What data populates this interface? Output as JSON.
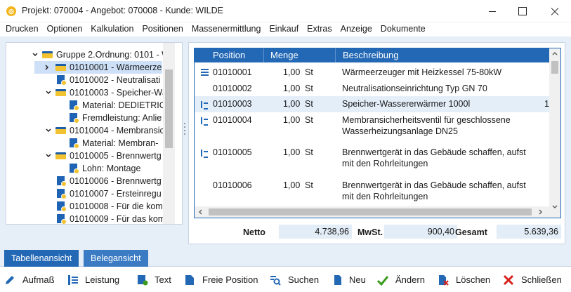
{
  "window": {
    "title": "Projekt: 070004 - Angebot: 070008 - Kunde: WILDE"
  },
  "menu": [
    "Drucken",
    "Optionen",
    "Kalkulation",
    "Positionen",
    "Massenermittlung",
    "Einkauf",
    "Extras",
    "Anzeige",
    "Dokumente"
  ],
  "tree": [
    {
      "label": "Gruppe 2.Ordnung: 0101 - W",
      "icon": "folder-icon"
    },
    {
      "label": "01010001 - Wärmeerze",
      "icon": "folder-icon"
    },
    {
      "label": "01010002 - Neutralisati",
      "icon": "document-icon"
    },
    {
      "label": "01010003 - Speicher-Wä",
      "icon": "folder-icon"
    },
    {
      "label": "Material: DEDIETRIC",
      "icon": "document-icon"
    },
    {
      "label": "Fremdleistung: Anlie",
      "icon": "document-icon"
    },
    {
      "label": "01010004 - Membransic",
      "icon": "folder-icon"
    },
    {
      "label": "Material: Membran-",
      "icon": "document-icon"
    },
    {
      "label": "01010005 - Brennwertg",
      "icon": "folder-icon"
    },
    {
      "label": "Lohn: Montage",
      "icon": "document-icon"
    },
    {
      "label": "01010006 - Brennwertg",
      "icon": "document-icon"
    },
    {
      "label": "01010007 - Ersteinregu",
      "icon": "document-icon"
    },
    {
      "label": "01010008 - Für die kom",
      "icon": "document-icon"
    },
    {
      "label": "01010009 - Für das kom",
      "icon": "document-icon"
    }
  ],
  "grid": {
    "headers": {
      "position": "Position",
      "menge": "Menge",
      "beschreibung": "Beschreibung"
    },
    "rows": [
      {
        "icon": "list-lines-icon",
        "position": "01010001",
        "menge": "1,00",
        "unit": "St",
        "desc1": "Wärmeerzeuger mit Heizkessel 75-80kW",
        "desc2": ""
      },
      {
        "icon": "",
        "position": "01010002",
        "menge": "1,00",
        "unit": "St",
        "desc1": "Neutralisationseinrichtung Typ GN 70",
        "desc2": ""
      },
      {
        "icon": "calculation-icon",
        "position": "01010003",
        "menge": "1,00",
        "unit": "St",
        "desc1": "Speicher-Wassererwärmer 1000l",
        "desc2": "",
        "trail": "1"
      },
      {
        "icon": "calculation-icon",
        "position": "01010004",
        "menge": "1,00",
        "unit": "St",
        "desc1": "Membransicherheitsventil für geschlossene",
        "desc2": "Wasserheizungsanlage DN25"
      },
      {
        "icon": "calculation-icon",
        "position": "01010005",
        "menge": "1,00",
        "unit": "St",
        "desc1": "Brennwertgerät in das Gebäude schaffen, aufst",
        "desc2": "mit den Rohrleitungen"
      },
      {
        "icon": "",
        "position": "01010006",
        "menge": "1,00",
        "unit": "St",
        "desc1": "Brennwertgerät in das Gebäude schaffen, aufst",
        "desc2": "mit den Rohrleitungen"
      }
    ]
  },
  "totals": {
    "netto_label": "Netto",
    "netto_value": "4.738,96",
    "mwst_label": "MwSt.",
    "mwst_value": "900,40",
    "gesamt_label": "Gesamt",
    "gesamt_value": "5.639,36"
  },
  "tabs": {
    "active": "Tabellenansicht",
    "inactive": "Belegansicht"
  },
  "toolbar": {
    "aufmass": "Aufmaß",
    "leistung": "Leistung",
    "text": "Text",
    "freie_position": "Freie Position",
    "suchen": "Suchen",
    "neu": "Neu",
    "aendern": "Ändern",
    "loeschen": "Löschen",
    "schliessen": "Schließen"
  },
  "colors": {
    "accent": "#2368b5",
    "panel_bg": "#e6eef8",
    "folder": "#f2c230",
    "check": "#3b9c1e",
    "close": "#d6221b"
  }
}
